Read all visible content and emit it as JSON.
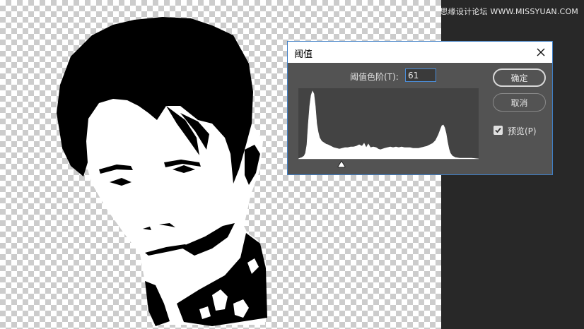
{
  "watermark": {
    "site_name": "思缘设计论坛",
    "url": "WWW.MISSYUAN.COM"
  },
  "dialog": {
    "title": "阈值",
    "threshold_label": "阈值色阶(T):",
    "threshold_value": "61",
    "ok_label": "确定",
    "cancel_label": "取消",
    "preview_label": "预览(P)",
    "preview_checked": true,
    "slider_level": 61,
    "histogram_levels": [
      0,
      255
    ]
  },
  "colors": {
    "dialog_bg": "#535353",
    "histogram_bg": "#434343",
    "accent_border": "#3f7fc6",
    "panel_bg": "#282828"
  }
}
